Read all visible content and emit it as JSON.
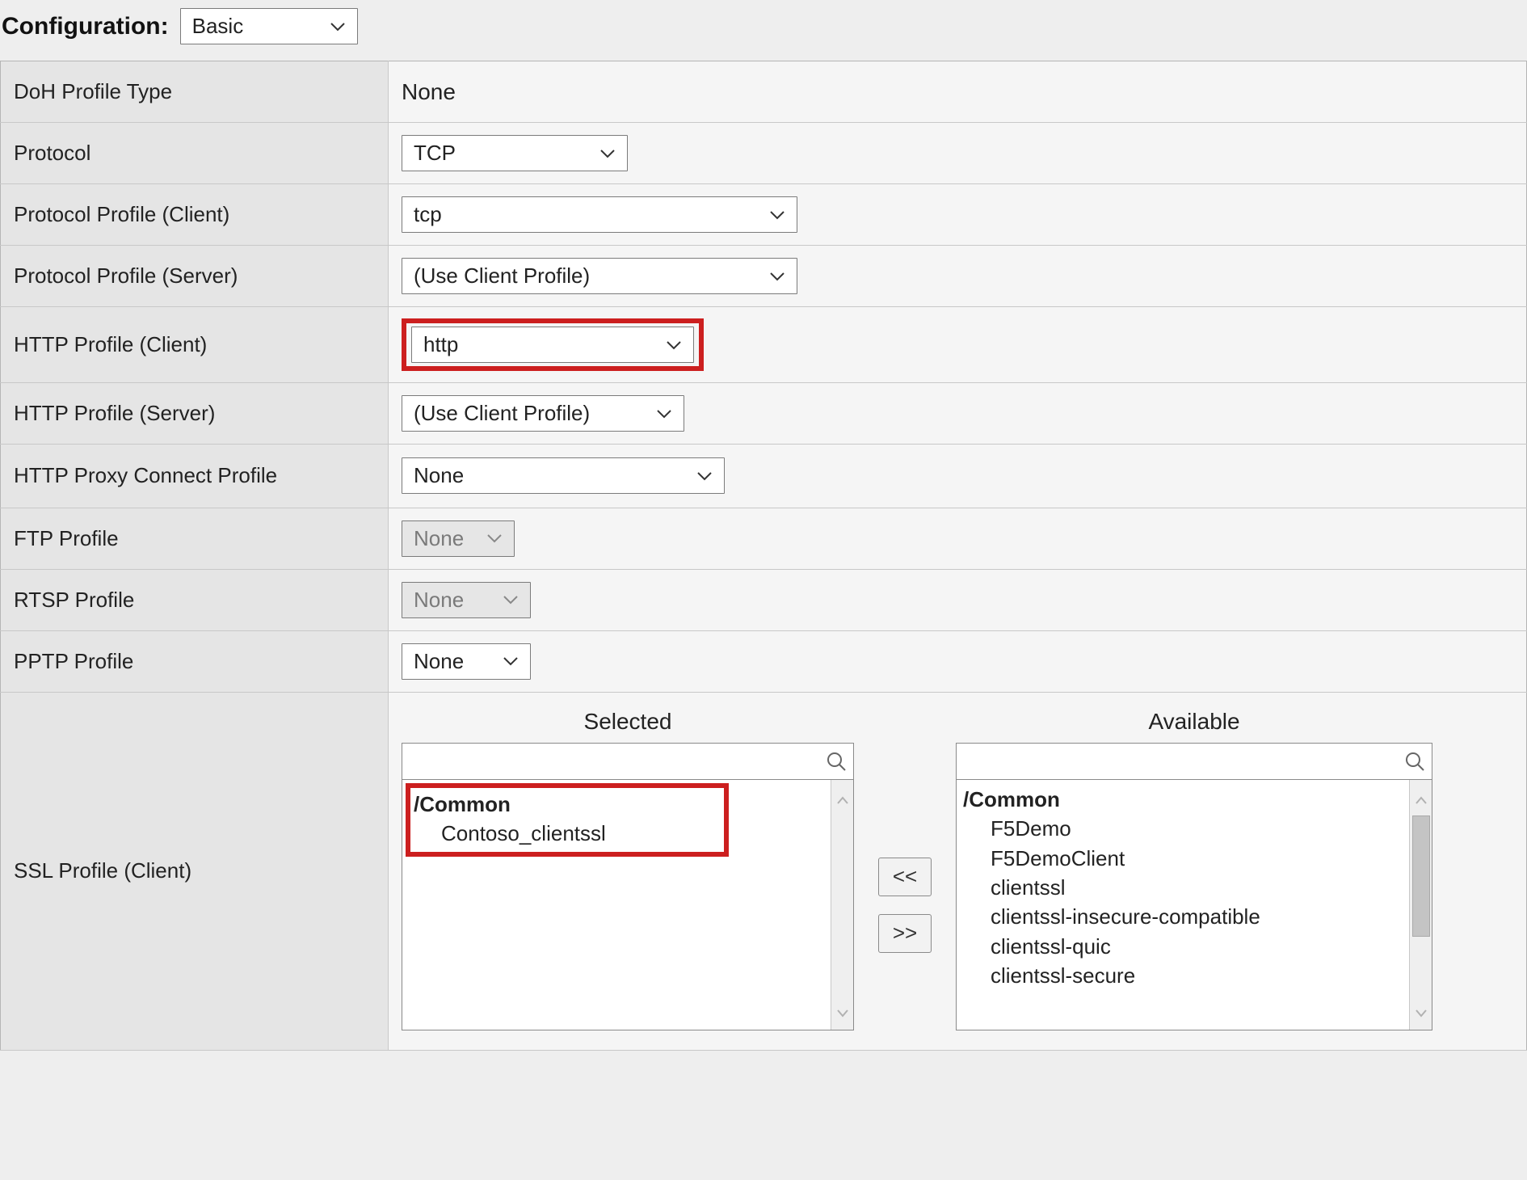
{
  "heading": {
    "label": "Configuration:",
    "select_value": "Basic"
  },
  "rows": {
    "doh_profile_type": {
      "label": "DoH Profile Type",
      "value": "None"
    },
    "protocol": {
      "label": "Protocol",
      "value": "TCP"
    },
    "protocol_profile_client": {
      "label": "Protocol Profile (Client)",
      "value": "tcp"
    },
    "protocol_profile_server": {
      "label": "Protocol Profile (Server)",
      "value": "(Use Client Profile)"
    },
    "http_profile_client": {
      "label": "HTTP Profile (Client)",
      "value": "http"
    },
    "http_profile_server": {
      "label": "HTTP Profile (Server)",
      "value": "(Use Client Profile)"
    },
    "http_proxy_connect_profile": {
      "label": "HTTP Proxy Connect Profile",
      "value": "None"
    },
    "ftp_profile": {
      "label": "FTP Profile",
      "value": "None"
    },
    "rtsp_profile": {
      "label": "RTSP Profile",
      "value": "None"
    },
    "pptp_profile": {
      "label": "PPTP Profile",
      "value": "None"
    },
    "ssl_profile_client": {
      "label": "SSL Profile (Client)"
    }
  },
  "dual": {
    "selected_header": "Selected",
    "available_header": "Available",
    "move_left": "<<",
    "move_right": ">>",
    "selected": {
      "partition": "/Common",
      "items": [
        "Contoso_clientssl"
      ]
    },
    "available": {
      "partition": "/Common",
      "items": [
        "F5Demo",
        "F5DemoClient",
        "clientssl",
        "clientssl-insecure-compatible",
        "clientssl-quic",
        "clientssl-secure"
      ]
    }
  }
}
